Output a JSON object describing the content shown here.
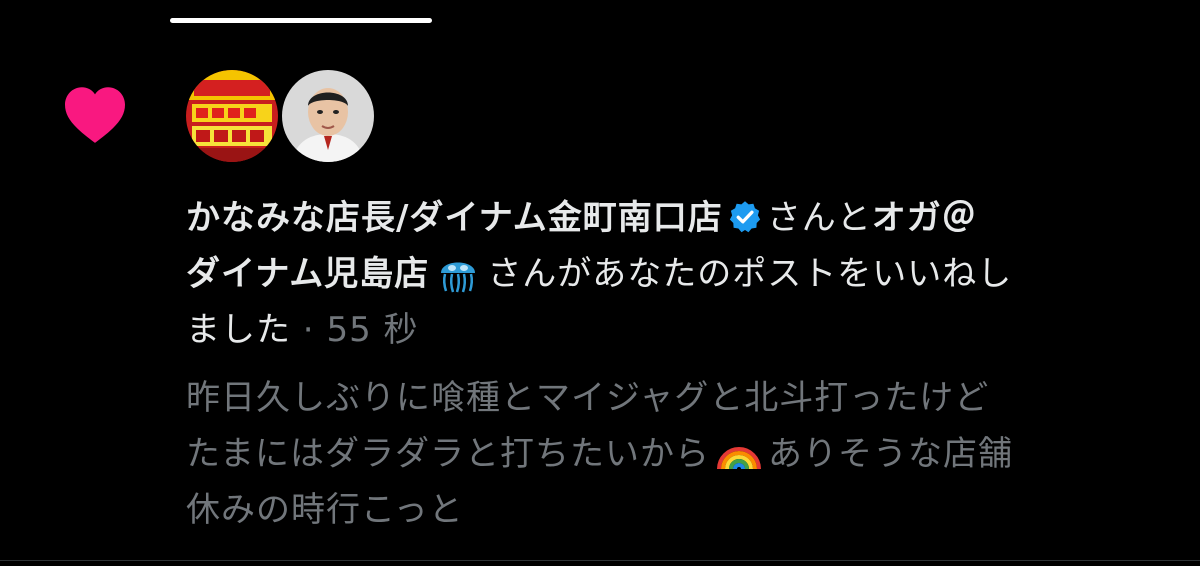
{
  "colors": {
    "background": "#000000",
    "heart": "#f91880",
    "text_primary": "#e7e9ea",
    "text_secondary": "#71767b",
    "verified_badge": "#1d9bf0"
  },
  "notification": {
    "type_icon": "heart-icon",
    "avatars": [
      {
        "icon": "store-logo-avatar"
      },
      {
        "icon": "person-avatar"
      }
    ],
    "user1": {
      "name": "かなみな店長/ダイナム金町南口店",
      "badge_icon": "verified-badge-icon"
    },
    "connector": "さんと",
    "user2": {
      "name_part1": "オガ＠",
      "name_part2": "ダイナム児島店",
      "emoji_icon": "jellyfish-emoji-icon"
    },
    "action_text_part1": "さんがあなたのポストをいいねし",
    "action_text_part2": "ました",
    "separator": " · ",
    "timestamp": "55 秒",
    "post_preview": {
      "line1": "昨日久しぶりに喰種とマイジャグと北斗打ったけど",
      "line2_part1": "たまにはダラダラと打ちたいから",
      "line2_emoji": "rainbow-emoji-icon",
      "line2_part2": "ありそうな店舗",
      "line3": "休みの時行こっと"
    }
  }
}
